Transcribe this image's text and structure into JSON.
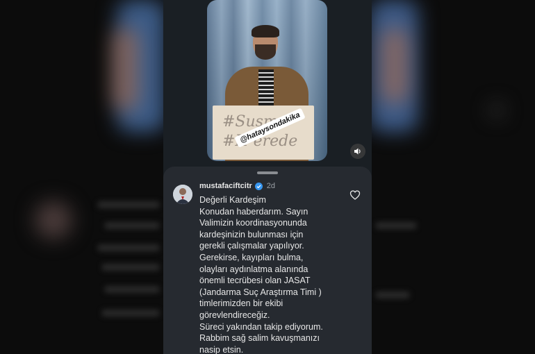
{
  "video": {
    "watermark": "@hataysondakika",
    "sign_line1": "#Susma",
    "sign_line2": "#H  erede"
  },
  "comment": {
    "username": "mustafaciftcitr",
    "time": "2d",
    "lines": [
      "Değerli Kardeşim",
      "Konudan haberdarım. Sayın",
      "Valimizin koordinasyonunda",
      "kardeşinizin bulunması için",
      "gerekli çalışmalar yapılıyor.",
      "Gerekirse, kayıpları bulma,",
      "olayları aydınlatma alanında",
      "önemli tecrübesi olan JASAT",
      "(Jandarma Suç Araştırma Timi )",
      "timlerimizden bir ekibi",
      "görevlendireceğiz.",
      "Süreci yakından takip ediyorum.",
      "Rabbim sağ salim kavuşmanızı",
      "nasip etsin."
    ]
  },
  "icons": {
    "sound": "speaker-icon",
    "like": "heart-icon",
    "verified": "verified-badge-icon"
  },
  "colors": {
    "sheet_bg": "#262a30",
    "verified_blue": "#3897f0",
    "text": "#e8e8e8",
    "muted": "#9aa0a6"
  }
}
